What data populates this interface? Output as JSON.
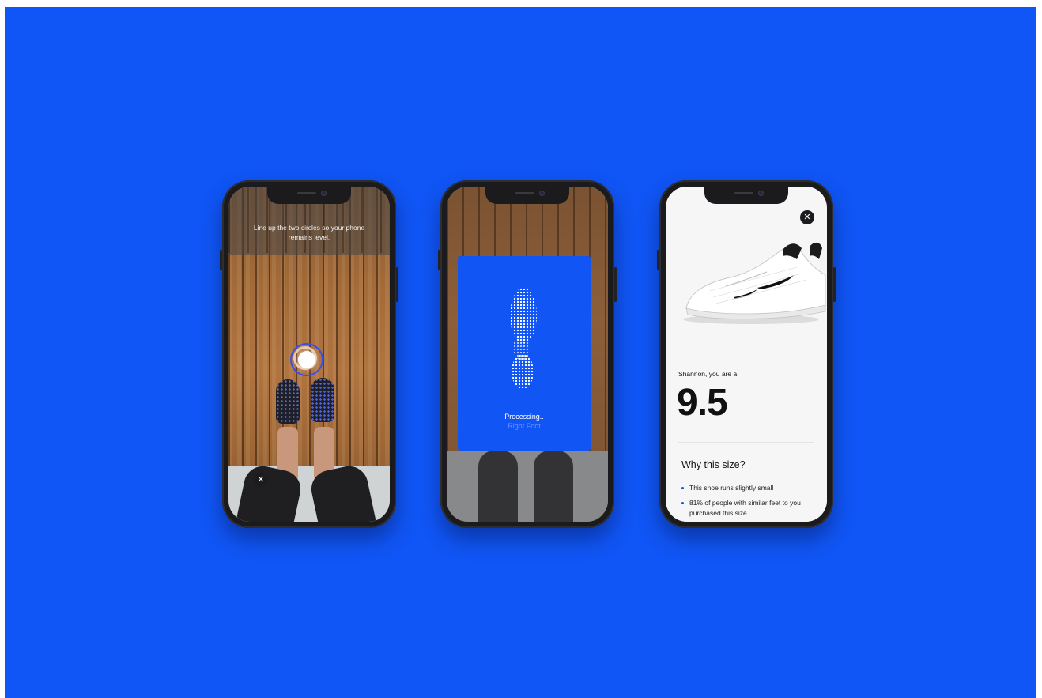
{
  "phones": [
    {
      "screen": "level-check",
      "instruction": "Line up the two circles so your phone remains level.",
      "close_label": "✕"
    },
    {
      "screen": "processing",
      "status_title": "Processing..",
      "status_sub": "Right Foot"
    },
    {
      "screen": "result",
      "close_label": "✕",
      "greeting": "Shannon, you are a",
      "size": "9.5",
      "section_title": "Why this size?",
      "reasons": [
        "This shoe runs slightly small",
        "81% of people with similar feet to you purchased this size."
      ]
    }
  ],
  "colors": {
    "background": "#1055f5",
    "accent": "#1255f5",
    "phone_body": "#1b1b1d"
  },
  "icons": [
    "close-icon",
    "level-circle-icon",
    "footprint-icon",
    "bullet-icon"
  ]
}
